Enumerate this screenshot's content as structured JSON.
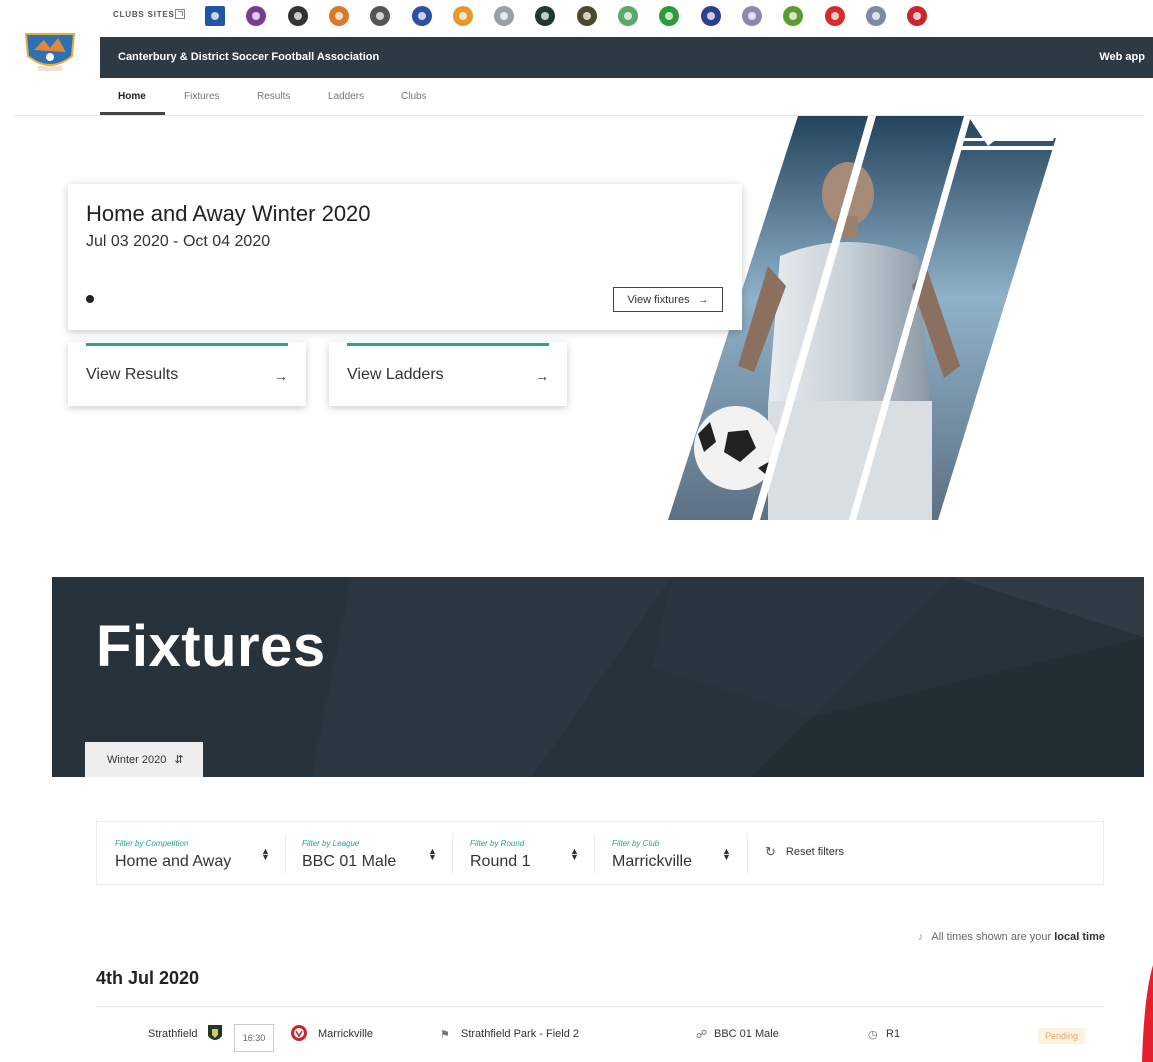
{
  "club_strip": {
    "label": "CLUBS SITES",
    "logos": [
      {
        "name": "club-logo-1",
        "color": "#1f56a6"
      },
      {
        "name": "club-logo-2",
        "color": "#7b3b8f"
      },
      {
        "name": "club-logo-3",
        "color": "#333333"
      },
      {
        "name": "club-logo-4",
        "color": "#d77a2b"
      },
      {
        "name": "club-logo-5",
        "color": "#555555"
      },
      {
        "name": "club-logo-6",
        "color": "#2b4fa3"
      },
      {
        "name": "club-logo-7",
        "color": "#e39a2e"
      },
      {
        "name": "club-logo-8",
        "color": "#9aa0a6"
      },
      {
        "name": "club-logo-9",
        "color": "#1b3a33"
      },
      {
        "name": "club-logo-10",
        "color": "#4a4a2a"
      },
      {
        "name": "club-logo-11",
        "color": "#5aa86a"
      },
      {
        "name": "club-logo-12",
        "color": "#2f9a3a"
      },
      {
        "name": "club-logo-13",
        "color": "#2c3e8f"
      },
      {
        "name": "club-logo-14",
        "color": "#8a8ab0"
      },
      {
        "name": "club-logo-15",
        "color": "#5d9a32"
      },
      {
        "name": "club-logo-16",
        "color": "#d62b2b"
      },
      {
        "name": "club-logo-17",
        "color": "#7d8aa8"
      },
      {
        "name": "club-logo-18",
        "color": "#c9252c"
      }
    ]
  },
  "header": {
    "association_name": "Canterbury & District Soccer Football Association",
    "web_app": "Web app",
    "bar_color": "#2e3a43"
  },
  "nav": {
    "items": [
      "Home",
      "Fixtures",
      "Results",
      "Ladders",
      "Clubs"
    ],
    "active": "Home"
  },
  "competition": {
    "title": "Home and Away Winter 2020",
    "dates": "Jul 03 2020 - Oct 04 2020",
    "view_fixtures": "View fixtures"
  },
  "quick_links": {
    "results": "View Results",
    "ladders": "View Ladders",
    "arrow": "→",
    "accent": "#1fa88f"
  },
  "fixtures_banner": {
    "title": "Fixtures",
    "season": "Winter 2020",
    "bg_color": "#27323a"
  },
  "filters": {
    "competition": {
      "caption": "Filter by Competition",
      "value": "Home and Away"
    },
    "league": {
      "caption": "Filter by League",
      "value": "BBC 01 Male"
    },
    "round": {
      "caption": "Filter by Round",
      "value": "Round 1"
    },
    "club": {
      "caption": "Filter by Club",
      "value": "Marrickville"
    },
    "reset": "Reset filters"
  },
  "timezone_notice": {
    "prefix": "All times shown are your",
    "emphasis": "local time"
  },
  "fixture_groups": [
    {
      "date": "4th Jul 2020",
      "fixtures": [
        {
          "home": "Strathfield",
          "time": "16:30",
          "away": "Marrickville",
          "venue": "Strathfield Park - Field 2",
          "league": "BBC 01 Male",
          "round": "R1",
          "status": "Pending"
        }
      ]
    }
  ]
}
